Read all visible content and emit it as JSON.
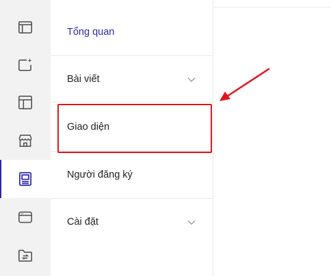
{
  "rail": {
    "items": [
      {
        "icon": "browser-window-icon"
      },
      {
        "icon": "add-sparkle-icon"
      },
      {
        "icon": "layout-icon"
      },
      {
        "icon": "store-icon"
      },
      {
        "icon": "page-design-icon",
        "active": true
      },
      {
        "icon": "card-window-icon"
      },
      {
        "icon": "folder-sync-icon"
      }
    ]
  },
  "menu": {
    "items": [
      {
        "label": "Tổng quan",
        "selected": true
      },
      {
        "label": "Bài viết",
        "expandable": true
      },
      {
        "label": "Giao diện"
      },
      {
        "label": "Người đăng ký"
      },
      {
        "label": "Cài đặt",
        "expandable": true
      }
    ]
  },
  "colors": {
    "accent": "#2b27a8",
    "annotation": "#e0141c",
    "rail_bg": "#f2f2f2",
    "icon": "#555555"
  }
}
